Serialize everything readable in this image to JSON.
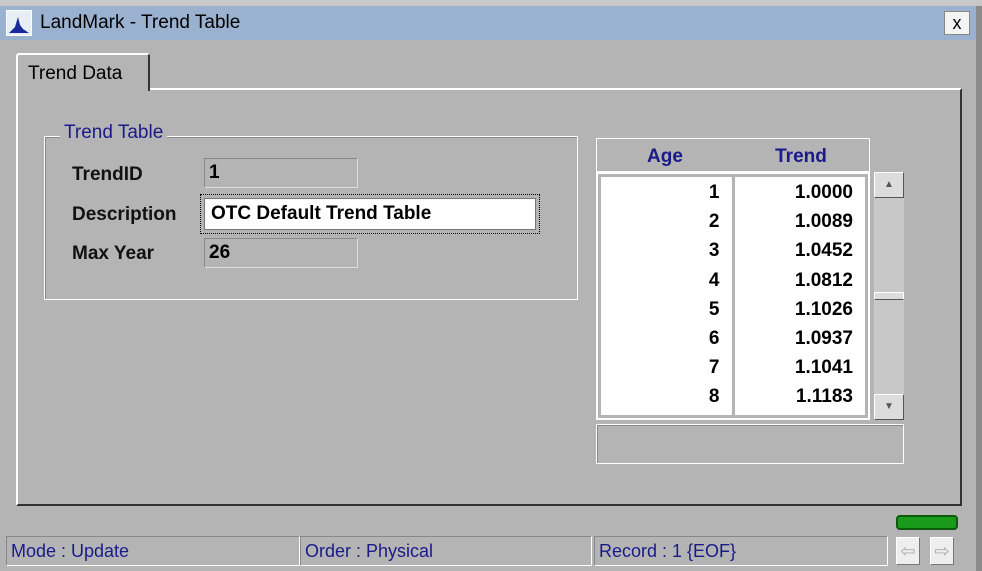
{
  "window": {
    "title": "LandMark - Trend Table",
    "close_label": "x"
  },
  "tabs": [
    {
      "label": "Trend Data"
    }
  ],
  "group": {
    "title": "Trend Table",
    "fields": {
      "trendid_label": "TrendID",
      "trendid_value": "1",
      "description_label": "Description",
      "description_value": "OTC Default Trend Table",
      "maxyear_label": "Max Year",
      "maxyear_value": "26"
    }
  },
  "grid": {
    "headers": [
      "Age",
      "Trend"
    ],
    "ages": [
      "1",
      "2",
      "3",
      "4",
      "5",
      "6",
      "7",
      "8"
    ],
    "trends": [
      "1.0000",
      "1.0089",
      "1.0452",
      "1.0812",
      "1.1026",
      "1.0937",
      "1.1041",
      "1.1183"
    ]
  },
  "status": {
    "mode": "Mode : Update",
    "order": "Order : Physical",
    "record": "Record : 1 {EOF}"
  },
  "colors": {
    "indicator": "#1a9a1a",
    "titlebar": "#9ab2cf"
  }
}
